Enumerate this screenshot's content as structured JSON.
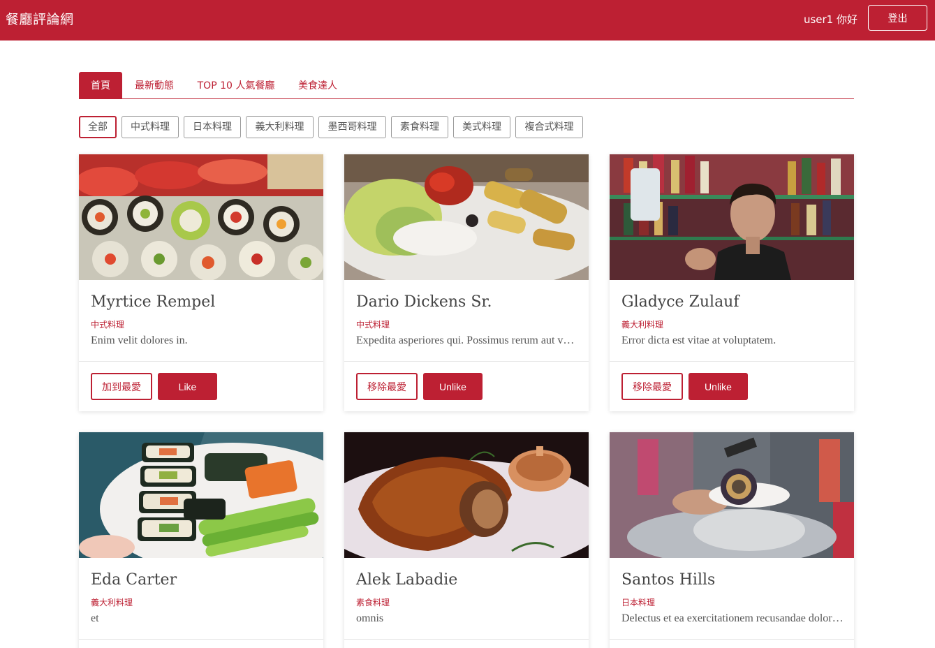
{
  "navbar": {
    "brand": "餐廳評論網",
    "greeting": "user1 你好",
    "logout_label": "登出"
  },
  "tabs": [
    {
      "label": "首頁",
      "active": true
    },
    {
      "label": "最新動態",
      "active": false
    },
    {
      "label": "TOP 10 人氣餐廳",
      "active": false
    },
    {
      "label": "美食達人",
      "active": false
    }
  ],
  "filters": [
    {
      "label": "全部",
      "active": true
    },
    {
      "label": "中式料理",
      "active": false
    },
    {
      "label": "日本料理",
      "active": false
    },
    {
      "label": "義大利料理",
      "active": false
    },
    {
      "label": "墨西哥料理",
      "active": false
    },
    {
      "label": "素食料理",
      "active": false
    },
    {
      "label": "美式料理",
      "active": false
    },
    {
      "label": "複合式料理",
      "active": false
    }
  ],
  "restaurants": [
    {
      "name": "Myrtice Rempel",
      "category": "中式料理",
      "description": "Enim velit dolores in.",
      "fav_label": "加到最愛",
      "like_label": "Like",
      "image": "sushi-rolls-photo"
    },
    {
      "name": "Dario Dickens Sr.",
      "category": "中式料理",
      "description": "Expedita asperiores qui. Possimus rerum aut voluptatem.",
      "fav_label": "移除最愛",
      "like_label": "Unlike",
      "image": "roasted-vegetables-photo"
    },
    {
      "name": "Gladyce Zulauf",
      "category": "義大利料理",
      "description": "Error dicta est vitae at voluptatem.",
      "fav_label": "移除最愛",
      "like_label": "Unlike",
      "image": "bartender-photo"
    },
    {
      "name": "Eda Carter",
      "category": "義大利料理",
      "description": "et",
      "fav_label": "",
      "like_label": "",
      "image": "maki-platter-photo"
    },
    {
      "name": "Alek Labadie",
      "category": "素食料理",
      "description": "omnis",
      "fav_label": "",
      "like_label": "",
      "image": "roast-pork-photo"
    },
    {
      "name": "Santos Hills",
      "category": "日本料理",
      "description": "Delectus et ea exercitationem recusandae dolorem.",
      "fav_label": "",
      "like_label": "",
      "image": "street-food-photo"
    }
  ],
  "colors": {
    "brand": "#bd2033",
    "text": "#333333"
  }
}
